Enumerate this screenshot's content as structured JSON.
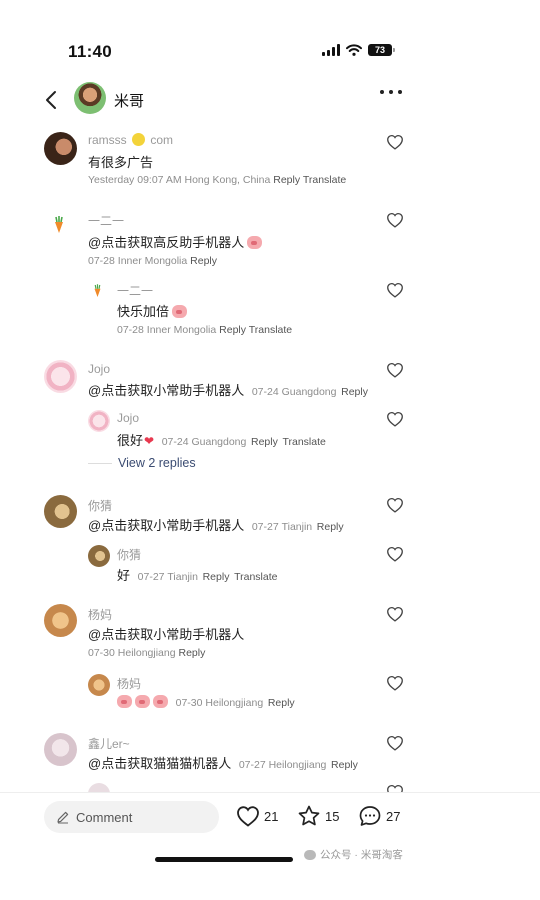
{
  "status_bar": {
    "time": "11:40",
    "battery": "73"
  },
  "nav": {
    "title": "米哥"
  },
  "comments": [
    {
      "user": "ramsss",
      "user_suffix": "com",
      "text": "有很多广告",
      "meta": "Yesterday 09:07 AM Hong Kong, China",
      "reply": "Reply",
      "translate": "Translate"
    },
    {
      "user": "一二一",
      "text": "@点击获取高反助手机器人",
      "meta": "07-28 Inner Mongolia",
      "reply": "Reply",
      "sub": {
        "user": "一二一",
        "text": "快乐加倍",
        "meta": "07-28 Inner Mongolia",
        "reply": "Reply",
        "translate": "Translate"
      }
    },
    {
      "user": "Jojo",
      "text": "@点击获取小常助手机器人",
      "meta": "07-24 Guangdong",
      "reply": "Reply",
      "sub": {
        "user": "Jojo",
        "text": "很好",
        "meta": "07-24 Guangdong",
        "reply": "Reply",
        "translate": "Translate"
      },
      "view_replies": "View 2 replies"
    },
    {
      "user": "你猜",
      "text": "@点击获取小常助手机器人",
      "meta": "07-27 Tianjin",
      "reply": "Reply",
      "sub": {
        "user": "你猜",
        "text": "好",
        "meta": "07-27 Tianjin",
        "reply": "Reply",
        "translate": "Translate"
      }
    },
    {
      "user": "杨妈",
      "text": "@点击获取小常助手机器人",
      "meta": "07-30 Heilongjiang",
      "reply": "Reply",
      "sub": {
        "user": "杨妈",
        "meta": "07-30 Heilongjiang",
        "reply": "Reply"
      }
    },
    {
      "user": "鑫儿er~",
      "text": "@点击获取猫猫猫机器人",
      "meta": "07-27 Heilongjiang",
      "reply": "Reply"
    }
  ],
  "bottom_bar": {
    "comment_placeholder": "Comment",
    "likes": "21",
    "favorites": "15",
    "comments": "27"
  },
  "watermark": "公众号 · 米哥淘客",
  "colors": {
    "link": "#3b4c72",
    "meta": "#8d8d8d",
    "accent_pig": "#f5a9ae",
    "coin": "#f3d33a",
    "heart_emoji": "#e8384f"
  }
}
